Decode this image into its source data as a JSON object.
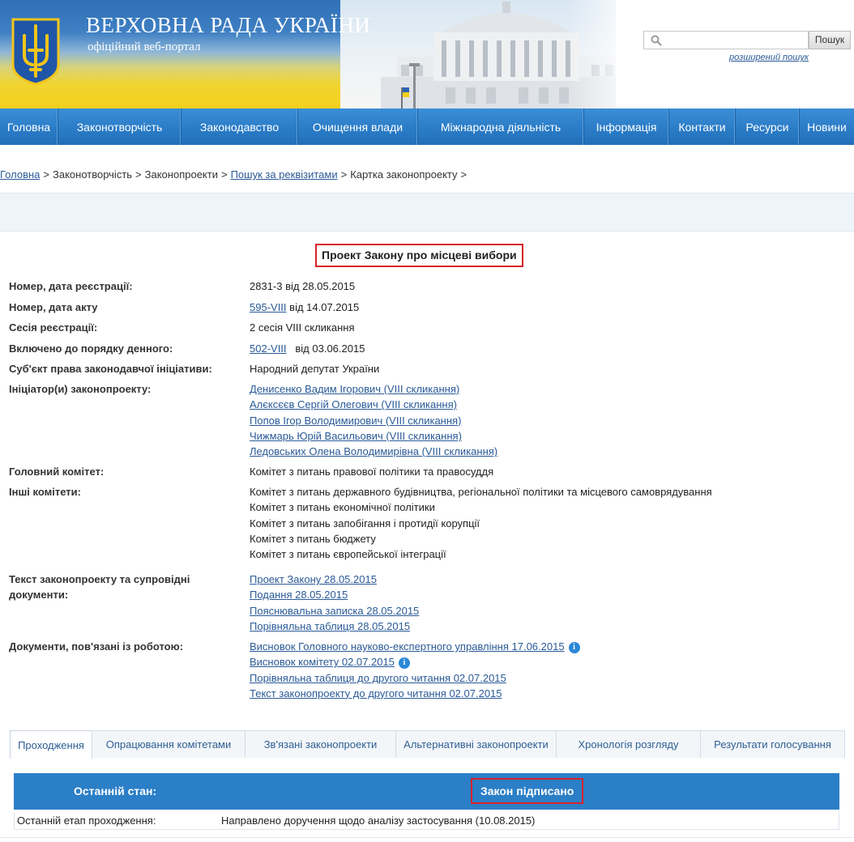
{
  "header": {
    "site_title": "ВЕРХОВНА РАДА УКРАЇНИ",
    "site_subtitle": "офіційний веб-портал",
    "search_placeholder": "",
    "search_button": "Пошук",
    "advanced_search": "розширений пошук"
  },
  "nav": {
    "items": [
      {
        "label": "Головна"
      },
      {
        "label": "Законотворчість"
      },
      {
        "label": "Законодавство"
      },
      {
        "label": "Очищення влади"
      },
      {
        "label": "Міжнародна діяльність"
      },
      {
        "label": "Інформація"
      },
      {
        "label": "Контакти"
      },
      {
        "label": "Ресурси"
      },
      {
        "label": "Новини"
      }
    ]
  },
  "breadcrumb": {
    "items": [
      "Головна",
      "Законотворчість",
      "Законопроекти",
      "Пошук за реквізитами",
      "Картка законопроекту"
    ],
    "separator": ">"
  },
  "bill": {
    "title": "Проект Закону про місцеві вибори",
    "reg_label": "Номер, дата реєстрації:",
    "reg_value": "2831-3 від 28.05.2015",
    "act_label": "Номер, дата акту",
    "act_number": "595-VIII",
    "act_date": "від 14.07.2015",
    "session_label": "Сесія реєстрації:",
    "session_value": "2 сесія VIII скликання",
    "agenda_label": "Включено до порядку денного:",
    "agenda_number": "502-VIII",
    "agenda_date": "від 03.06.2015",
    "subject_label": "Суб'єкт права законодавчої ініціативи:",
    "subject_value": "Народний депутат України",
    "initiators_label": "Ініціатор(и) законопроекту:",
    "initiators": [
      "Денисенко Вадим Ігорович (VIII скликання)",
      "Алєксєєв Сергій Олегович (VIII скликання)",
      "Попов Ігор Володимирович (VIII скликання)",
      "Чижмарь Юрій Васильович (VIII скликання)",
      "Ледовських Олена Володимирівна (VIII скликання)"
    ],
    "main_committee_label": "Головний комітет:",
    "main_committee_value": "Комітет з питань правової політики та правосуддя",
    "other_committees_label": "Інші комітети:",
    "other_committees": [
      "Комітет з питань державного будівництва, регіональної політики та місцевого самоврядування",
      "Комітет з питань економічної політики",
      "Комітет з питань запобігання і протидії корупції",
      "Комітет з питань бюджету",
      "Комітет з питань європейської інтеграції"
    ],
    "texts_label": "Текст законопроекту та супровідні документи:",
    "texts": [
      "Проект Закону 28.05.2015",
      "Подання 28.05.2015",
      "Пояснювальна записка 28.05.2015",
      "Порівняльна таблиця 28.05.2015"
    ],
    "docs_label": "Документи, пов'язані із роботою:",
    "docs": [
      "Висновок Головного науково-експертного управління 17.06.2015",
      "Висновок комітету 02.07.2015",
      "Порівняльна таблиця до другого читання 02.07.2015",
      "Текст законопроекту до другого читання 02.07.2015"
    ]
  },
  "tabs": {
    "items": [
      {
        "label": "Проходження"
      },
      {
        "label": "Опрацювання комітетами"
      },
      {
        "label": "Зв'язані законопроекти"
      },
      {
        "label": "Альтернативні законопроекти"
      },
      {
        "label": "Хронологія розгляду"
      },
      {
        "label": "Результати голосування"
      }
    ],
    "active": "Проходження"
  },
  "status": {
    "label": "Останній стан:",
    "value": "Закон підписано",
    "stage_label": "Останній етап проходження:",
    "stage_value": "Направлено доручення щодо аналізу застосування (10.08.2015)"
  },
  "colors": {
    "nav_blue": "#2b7cc7",
    "link": "#2a5a97",
    "highlight_border": "#d8222a",
    "flag_yellow": "#f5cf1c"
  }
}
